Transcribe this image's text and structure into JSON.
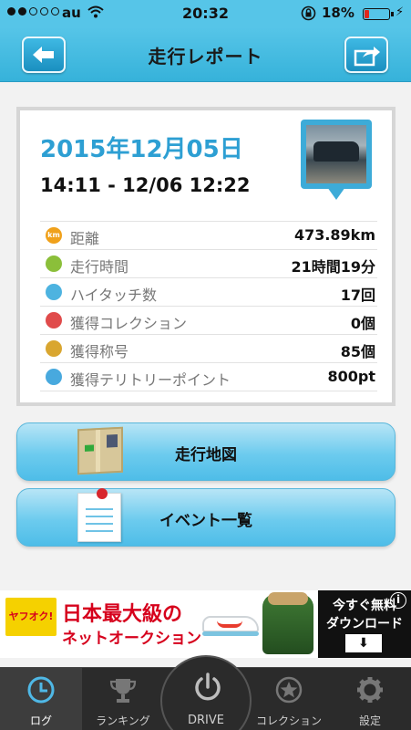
{
  "status_bar": {
    "carrier": "au",
    "time": "20:32",
    "battery_percent": "18%",
    "battery_level": 0.18,
    "signal_bars": 2,
    "icons": [
      "signal-dots-icon",
      "wifi-icon",
      "rotation-lock-icon",
      "battery-icon",
      "charging-icon"
    ]
  },
  "nav": {
    "title": "走行レポート",
    "back_icon": "arrow-left-icon",
    "share_icon": "share-icon"
  },
  "report": {
    "date": "2015年12月05日",
    "time_range": "14:11 - 12/06 12:22",
    "stats": [
      {
        "icon": "km-icon",
        "icon_text": "km",
        "label": "距離",
        "value": "473.89km",
        "color": "#f0a11b"
      },
      {
        "icon": "clock-icon",
        "icon_text": "",
        "label": "走行時間",
        "value": "21時間19分",
        "color": "#8bbf3a"
      },
      {
        "icon": "high-five-icon",
        "icon_text": "",
        "label": "ハイタッチ数",
        "value": "17回",
        "color": "#4db3e0"
      },
      {
        "icon": "car-collection-icon",
        "icon_text": "",
        "label": "獲得コレクション",
        "value": "0個",
        "color": "#e04b4b"
      },
      {
        "icon": "medal-icon",
        "icon_text": "",
        "label": "獲得称号",
        "value": "85個",
        "color": "#d9a630"
      },
      {
        "icon": "territory-icon",
        "icon_text": "",
        "label": "獲得テリトリーポイント",
        "value": "800pt",
        "color": "#48a9de"
      }
    ]
  },
  "buttons": {
    "map_label": "走行地図",
    "event_label": "イベント一覧"
  },
  "ad": {
    "logo": "ヤフオク!",
    "headline": "日本最大級の",
    "subline": "ネットオークション",
    "cta_line1": "今すぐ無料",
    "cta_line2": "ダウンロード",
    "cta_icon": "download-icon",
    "info": "i"
  },
  "tabs": [
    {
      "label": "ログ",
      "icon": "log-clock-icon",
      "active": true
    },
    {
      "label": "ランキング",
      "icon": "trophy-icon",
      "active": false
    },
    {
      "label": "DRIVE",
      "icon": "power-icon",
      "active": false
    },
    {
      "label": "コレクション",
      "icon": "star-icon",
      "active": false
    },
    {
      "label": "設定",
      "icon": "gear-icon",
      "active": false
    }
  ],
  "colors": {
    "accent": "#56c5e8",
    "date_blue": "#2d9fd3",
    "ad_red": "#d6001c",
    "tab_bar": "#2b2b2b"
  }
}
